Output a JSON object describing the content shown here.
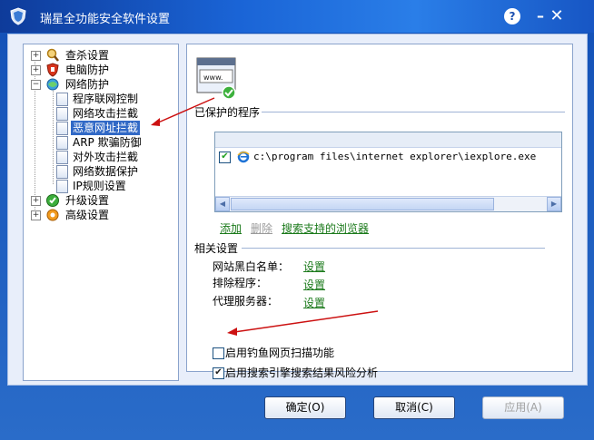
{
  "window": {
    "title": "瑞星全功能安全软件设置",
    "help_label": "?",
    "minimize_label": "–",
    "close_label": "✕"
  },
  "tree": {
    "items": [
      {
        "label": "查杀设置",
        "expander": "+",
        "icon": "magnifier-icon"
      },
      {
        "label": "电脑防护",
        "expander": "+",
        "icon": "shield-icon"
      },
      {
        "label": "网络防护",
        "expander": "−",
        "icon": "network-icon"
      },
      {
        "label": "程序联网控制",
        "icon": "page-icon"
      },
      {
        "label": "网络攻击拦截",
        "icon": "page-icon"
      },
      {
        "label": "恶意网址拦截",
        "icon": "page-icon",
        "selected": true
      },
      {
        "label": "ARP 欺骗防御",
        "icon": "page-icon"
      },
      {
        "label": "对外攻击拦截",
        "icon": "page-icon"
      },
      {
        "label": "网络数据保护",
        "icon": "page-icon"
      },
      {
        "label": "IP规则设置",
        "icon": "page-icon"
      },
      {
        "label": "升级设置",
        "expander": "+",
        "icon": "update-icon"
      },
      {
        "label": "高级设置",
        "expander": "+",
        "icon": "advanced-icon"
      }
    ]
  },
  "protected": {
    "section_title": "已保护的程序",
    "logo_text": "www.",
    "rows": [
      {
        "checked": true,
        "path": "c:\\program files\\internet explorer\\iexplore.exe"
      }
    ],
    "actions": {
      "add": "添加",
      "delete": "删除",
      "search": "搜索支持的浏览器"
    }
  },
  "related": {
    "section_title": "相关设置",
    "items": [
      {
        "label": "网站黑白名单：",
        "link": "设置"
      },
      {
        "label": "排除程序：",
        "link": "设置"
      },
      {
        "label": "代理服务器：",
        "link": "设置"
      }
    ]
  },
  "options": {
    "phishing_scan": {
      "label": "启用钓鱼网页扫描功能",
      "checked": false
    },
    "search_risk": {
      "label": "启用搜索引擎搜索结果风险分析",
      "checked": true
    }
  },
  "buttons": {
    "ok": "确定(O)",
    "cancel": "取消(C)",
    "apply": "应用(A)"
  },
  "colors": {
    "title_bar": "#1a64d6",
    "link_green": "#1b7a1b",
    "annotation_red": "#cc1111",
    "selection_blue": "#3169c6"
  }
}
